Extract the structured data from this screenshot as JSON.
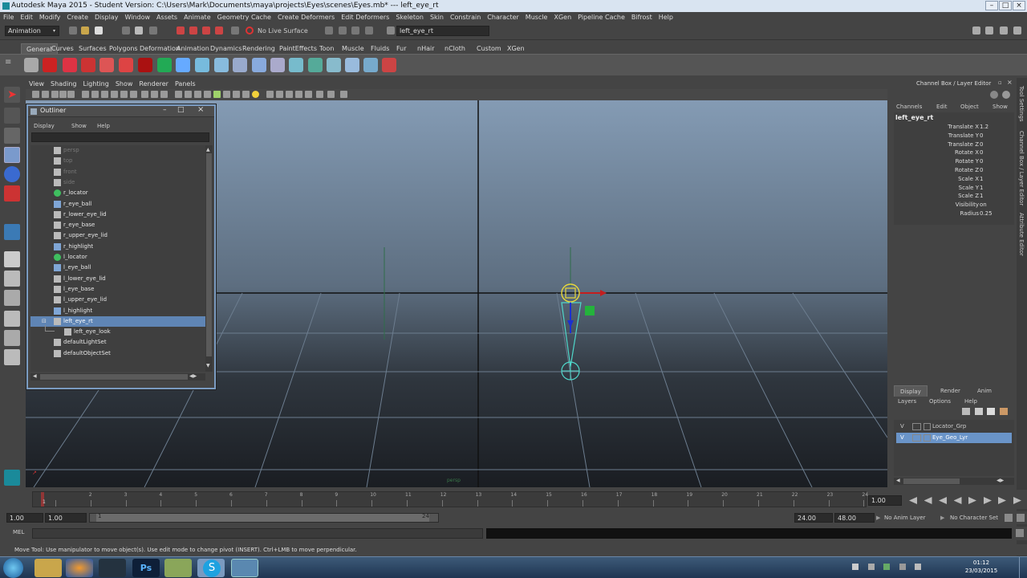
{
  "window": {
    "title": "Autodesk Maya 2015 - Student Version: C:\\Users\\Mark\\Documents\\maya\\projects\\Eyes\\scenes\\Eyes.mb*   ---   left_eye_rt"
  },
  "menubar": [
    "File",
    "Edit",
    "Modify",
    "Create",
    "Display",
    "Window",
    "Assets",
    "Animate",
    "Geometry Cache",
    "Create Deformers",
    "Edit Deformers",
    "Skeleton",
    "Skin",
    "Constrain",
    "Character",
    "Muscle",
    "XGen",
    "Pipeline Cache",
    "Bifrost",
    "Help"
  ],
  "status": {
    "mode": "Animation",
    "live_surface": "No Live Surface",
    "selection_field": "left_eye_rt"
  },
  "shelf_tabs": [
    "General",
    "Curves",
    "Surfaces",
    "Polygons",
    "Deformation",
    "Animation",
    "Dynamics",
    "Rendering",
    "PaintEffects",
    "Toon",
    "Muscle",
    "Fluids",
    "Fur",
    "nHair",
    "nCloth",
    "Custom",
    "XGen"
  ],
  "viewport_menu": [
    "View",
    "Shading",
    "Lighting",
    "Show",
    "Renderer",
    "Panels"
  ],
  "outliner": {
    "title": "Outliner",
    "menu": [
      "Display",
      "Show",
      "Help"
    ],
    "items": [
      {
        "label": "persp",
        "dim": true,
        "icon": "camera-icon",
        "indent": 0
      },
      {
        "label": "top",
        "dim": true,
        "icon": "camera-icon",
        "indent": 0
      },
      {
        "label": "front",
        "dim": true,
        "icon": "camera-icon",
        "indent": 0
      },
      {
        "label": "side",
        "dim": true,
        "icon": "camera-icon",
        "indent": 0
      },
      {
        "label": "r_locator",
        "dim": false,
        "icon": "locator-icon",
        "indent": 0
      },
      {
        "label": "r_eye_ball",
        "dim": false,
        "icon": "mesh-icon",
        "indent": 0
      },
      {
        "label": "r_lower_eye_lid",
        "dim": false,
        "icon": "curve-icon",
        "indent": 0
      },
      {
        "label": "r_eye_base",
        "dim": false,
        "icon": "curve-icon",
        "indent": 0
      },
      {
        "label": "r_upper_eye_lid",
        "dim": false,
        "icon": "curve-icon",
        "indent": 0
      },
      {
        "label": "r_highlight",
        "dim": false,
        "icon": "mesh-icon",
        "indent": 0
      },
      {
        "label": "l_locator",
        "dim": false,
        "icon": "locator-icon",
        "indent": 0
      },
      {
        "label": "l_eye_ball",
        "dim": false,
        "icon": "mesh-icon",
        "indent": 0
      },
      {
        "label": "l_lower_eye_lid",
        "dim": false,
        "icon": "curve-icon",
        "indent": 0
      },
      {
        "label": "l_eye_base",
        "dim": false,
        "icon": "curve-icon",
        "indent": 0
      },
      {
        "label": "l_upper_eye_lid",
        "dim": false,
        "icon": "curve-icon",
        "indent": 0
      },
      {
        "label": "l_highlight",
        "dim": false,
        "icon": "mesh-icon",
        "indent": 0
      },
      {
        "label": "left_eye_rt",
        "dim": false,
        "icon": "joint-icon",
        "indent": 0,
        "selected": true
      },
      {
        "label": "left_eye_look",
        "dim": false,
        "icon": "joint-icon",
        "indent": 1
      },
      {
        "label": "defaultLightSet",
        "dim": false,
        "icon": "set-icon",
        "indent": 0
      },
      {
        "label": "defaultObjectSet",
        "dim": false,
        "icon": "set-icon",
        "indent": 0
      }
    ]
  },
  "channel_box": {
    "title": "Channel Box / Layer Editor",
    "menu": [
      "Channels",
      "Edit",
      "Object",
      "Show"
    ],
    "object": "left_eye_rt",
    "channels": [
      {
        "name": "Translate X",
        "value": "1.2"
      },
      {
        "name": "Translate Y",
        "value": "0"
      },
      {
        "name": "Translate Z",
        "value": "0"
      },
      {
        "name": "Rotate X",
        "value": "0"
      },
      {
        "name": "Rotate Y",
        "value": "0"
      },
      {
        "name": "Rotate Z",
        "value": "0"
      },
      {
        "name": "Scale X",
        "value": "1"
      },
      {
        "name": "Scale Y",
        "value": "1"
      },
      {
        "name": "Scale Z",
        "value": "1"
      },
      {
        "name": "Visibility",
        "value": "on"
      },
      {
        "name": "Radius",
        "value": "0.25"
      }
    ],
    "layer_tabs": [
      "Display",
      "Render",
      "Anim"
    ],
    "layer_menu": [
      "Layers",
      "Options",
      "Help"
    ],
    "layers": [
      {
        "v": "V",
        "name": "Locator_Grp",
        "selected": false
      },
      {
        "v": "V",
        "name": "Eye_Geo_Lyr",
        "selected": true
      }
    ]
  },
  "side_tabs": [
    "Tool Settings",
    "Channel Box / Layer Editor",
    "Attribute Editor"
  ],
  "timeline": {
    "ticks": [
      "1",
      "2",
      "3",
      "4",
      "5",
      "6",
      "7",
      "8",
      "9",
      "10",
      "11",
      "12",
      "13",
      "14",
      "15",
      "16",
      "17",
      "18",
      "19",
      "20",
      "21",
      "22",
      "23",
      "24"
    ],
    "current": "1.00"
  },
  "range": {
    "start": "1.00",
    "start2": "1.00",
    "slider_start": "1",
    "slider_end": "24",
    "end": "24.00",
    "end2": "48.00",
    "anim_layer": "No Anim Layer",
    "character": "No Character Set"
  },
  "mel": {
    "label": "MEL"
  },
  "help_line": "Move Tool: Use manipulator to move object(s). Use edit mode to change pivot (INSERT). Ctrl+LMB to move perpendicular.",
  "taskbar": {
    "time": "01:12",
    "date": "23/03/2015"
  },
  "viewport": {
    "label": "persp"
  }
}
